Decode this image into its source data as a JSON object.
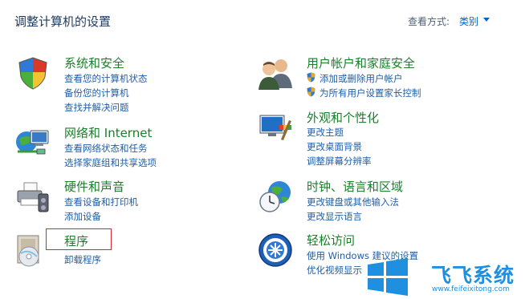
{
  "header": {
    "title": "调整计算机的设置",
    "view_by_label": "查看方式:",
    "view_by_value": "类别"
  },
  "categories": [
    {
      "title": "系统和安全",
      "icon": "shield-icon",
      "links": [
        "查看您的计算机状态",
        "备份您的计算机",
        "查找并解决问题"
      ]
    },
    {
      "title": "网络和 Internet",
      "icon": "network-icon",
      "links": [
        "查看网络状态和任务",
        "选择家庭组和共享选项"
      ]
    },
    {
      "title": "硬件和声音",
      "icon": "printer-icon",
      "links": [
        "查看设备和打印机",
        "添加设备"
      ]
    },
    {
      "title": "程序",
      "icon": "programs-icon",
      "links": [
        "卸载程序"
      ]
    },
    {
      "title": "用户帐户和家庭安全",
      "icon": "users-icon",
      "links": [
        "添加或删除用户帐户",
        "为所有用户设置家长控制"
      ]
    },
    {
      "title": "外观和个性化",
      "icon": "appearance-icon",
      "links": [
        "更改主题",
        "更改桌面背景",
        "调整屏幕分辨率"
      ]
    },
    {
      "title": "时钟、语言和区域",
      "icon": "clock-globe-icon",
      "links": [
        "更改键盘或其他输入法",
        "更改显示语言"
      ]
    },
    {
      "title": "轻松访问",
      "icon": "ease-of-access-icon",
      "links": [
        "使用 Windows 建议的设置",
        "优化视频显示"
      ]
    }
  ],
  "watermark": {
    "brand": "飞飞系统",
    "url": "www.feifeixitong.com"
  },
  "colors": {
    "category_title": "#1a7f2a",
    "link": "#1f5ea8",
    "highlight": "#d7262d"
  }
}
